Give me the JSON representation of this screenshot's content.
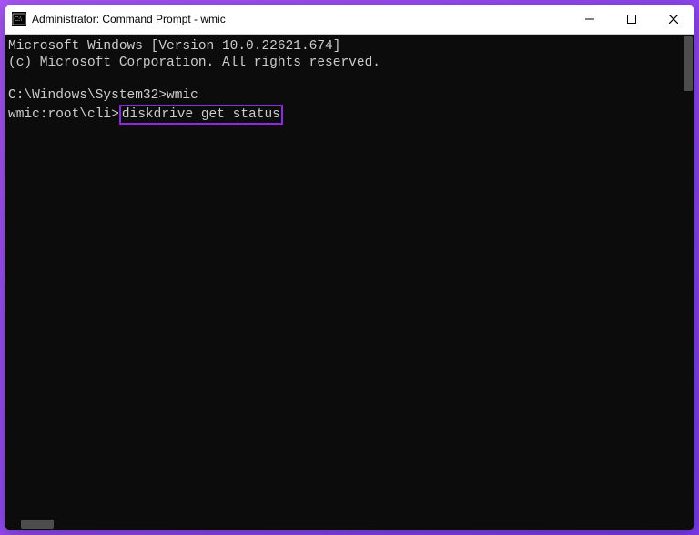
{
  "titlebar": {
    "title": "Administrator: Command Prompt - wmic"
  },
  "terminal": {
    "line1": "Microsoft Windows [Version 10.0.22621.674]",
    "line2": "(c) Microsoft Corporation. All rights reserved.",
    "blank": "",
    "prompt1_path": "C:\\Windows\\System32>",
    "prompt1_cmd": "wmic",
    "prompt2_path": "wmic:root\\cli>",
    "prompt2_cmd": "diskdrive get status"
  }
}
